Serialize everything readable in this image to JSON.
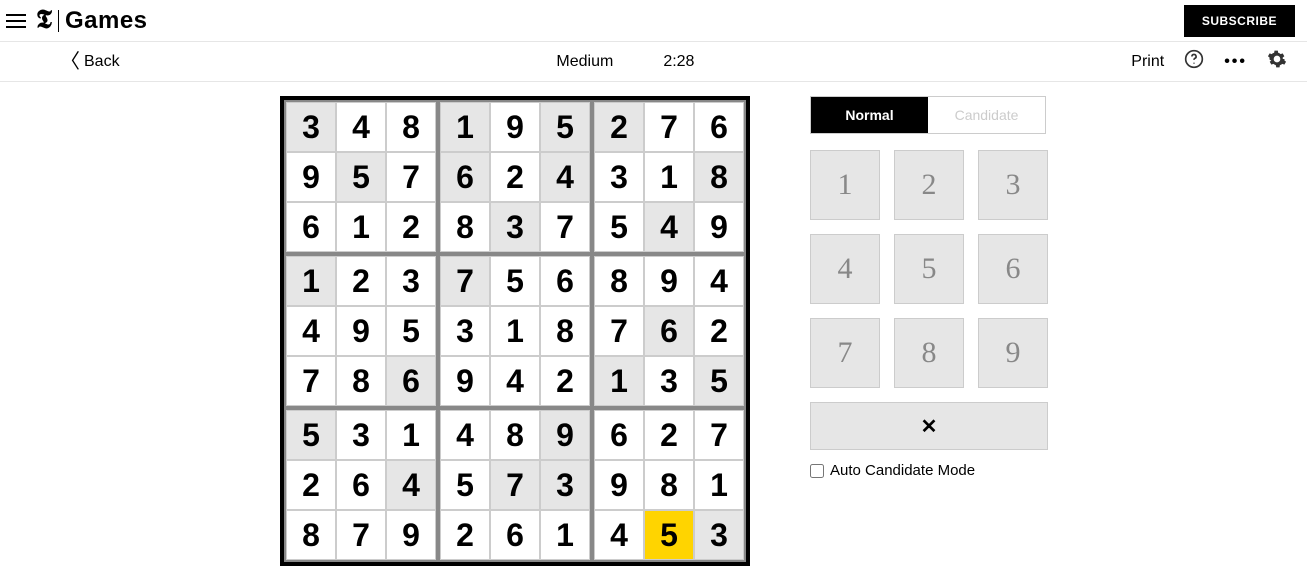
{
  "header": {
    "logo_t": "𝕿",
    "logo_games": "Games",
    "subscribe": "SUBSCRIBE"
  },
  "game_header": {
    "back": "Back",
    "difficulty": "Medium",
    "timer": "2:28",
    "print": "Print"
  },
  "board": {
    "selected": [
      8,
      7
    ],
    "rows": [
      [
        {
          "v": "3",
          "p": true
        },
        {
          "v": "4",
          "p": false
        },
        {
          "v": "8",
          "p": false
        },
        {
          "v": "1",
          "p": true
        },
        {
          "v": "9",
          "p": false
        },
        {
          "v": "5",
          "p": true
        },
        {
          "v": "2",
          "p": true
        },
        {
          "v": "7",
          "p": false
        },
        {
          "v": "6",
          "p": false
        }
      ],
      [
        {
          "v": "9",
          "p": false
        },
        {
          "v": "5",
          "p": true
        },
        {
          "v": "7",
          "p": false
        },
        {
          "v": "6",
          "p": true
        },
        {
          "v": "2",
          "p": false
        },
        {
          "v": "4",
          "p": true
        },
        {
          "v": "3",
          "p": false
        },
        {
          "v": "1",
          "p": false
        },
        {
          "v": "8",
          "p": true
        }
      ],
      [
        {
          "v": "6",
          "p": false
        },
        {
          "v": "1",
          "p": false
        },
        {
          "v": "2",
          "p": false
        },
        {
          "v": "8",
          "p": false
        },
        {
          "v": "3",
          "p": true
        },
        {
          "v": "7",
          "p": false
        },
        {
          "v": "5",
          "p": false
        },
        {
          "v": "4",
          "p": true
        },
        {
          "v": "9",
          "p": false
        }
      ],
      [
        {
          "v": "1",
          "p": true
        },
        {
          "v": "2",
          "p": false
        },
        {
          "v": "3",
          "p": false
        },
        {
          "v": "7",
          "p": true
        },
        {
          "v": "5",
          "p": false
        },
        {
          "v": "6",
          "p": false
        },
        {
          "v": "8",
          "p": false
        },
        {
          "v": "9",
          "p": false
        },
        {
          "v": "4",
          "p": false
        }
      ],
      [
        {
          "v": "4",
          "p": false
        },
        {
          "v": "9",
          "p": false
        },
        {
          "v": "5",
          "p": false
        },
        {
          "v": "3",
          "p": false
        },
        {
          "v": "1",
          "p": false
        },
        {
          "v": "8",
          "p": false
        },
        {
          "v": "7",
          "p": false
        },
        {
          "v": "6",
          "p": true
        },
        {
          "v": "2",
          "p": false
        }
      ],
      [
        {
          "v": "7",
          "p": false
        },
        {
          "v": "8",
          "p": false
        },
        {
          "v": "6",
          "p": true
        },
        {
          "v": "9",
          "p": false
        },
        {
          "v": "4",
          "p": false
        },
        {
          "v": "2",
          "p": false
        },
        {
          "v": "1",
          "p": true
        },
        {
          "v": "3",
          "p": false
        },
        {
          "v": "5",
          "p": true
        }
      ],
      [
        {
          "v": "5",
          "p": true
        },
        {
          "v": "3",
          "p": false
        },
        {
          "v": "1",
          "p": false
        },
        {
          "v": "4",
          "p": false
        },
        {
          "v": "8",
          "p": false
        },
        {
          "v": "9",
          "p": true
        },
        {
          "v": "6",
          "p": false
        },
        {
          "v": "2",
          "p": false
        },
        {
          "v": "7",
          "p": false
        }
      ],
      [
        {
          "v": "2",
          "p": false
        },
        {
          "v": "6",
          "p": false
        },
        {
          "v": "4",
          "p": true
        },
        {
          "v": "5",
          "p": false
        },
        {
          "v": "7",
          "p": true
        },
        {
          "v": "3",
          "p": true
        },
        {
          "v": "9",
          "p": false
        },
        {
          "v": "8",
          "p": false
        },
        {
          "v": "1",
          "p": false
        }
      ],
      [
        {
          "v": "8",
          "p": false
        },
        {
          "v": "7",
          "p": false
        },
        {
          "v": "9",
          "p": false
        },
        {
          "v": "2",
          "p": false
        },
        {
          "v": "6",
          "p": false
        },
        {
          "v": "1",
          "p": false
        },
        {
          "v": "4",
          "p": false
        },
        {
          "v": "5",
          "p": false
        },
        {
          "v": "3",
          "p": true
        }
      ]
    ]
  },
  "panel": {
    "mode_normal": "Normal",
    "mode_candidate": "Candidate",
    "numpad": [
      "1",
      "2",
      "3",
      "4",
      "5",
      "6",
      "7",
      "8",
      "9"
    ],
    "delete_glyph": "✕",
    "auto_label": "Auto Candidate Mode"
  }
}
